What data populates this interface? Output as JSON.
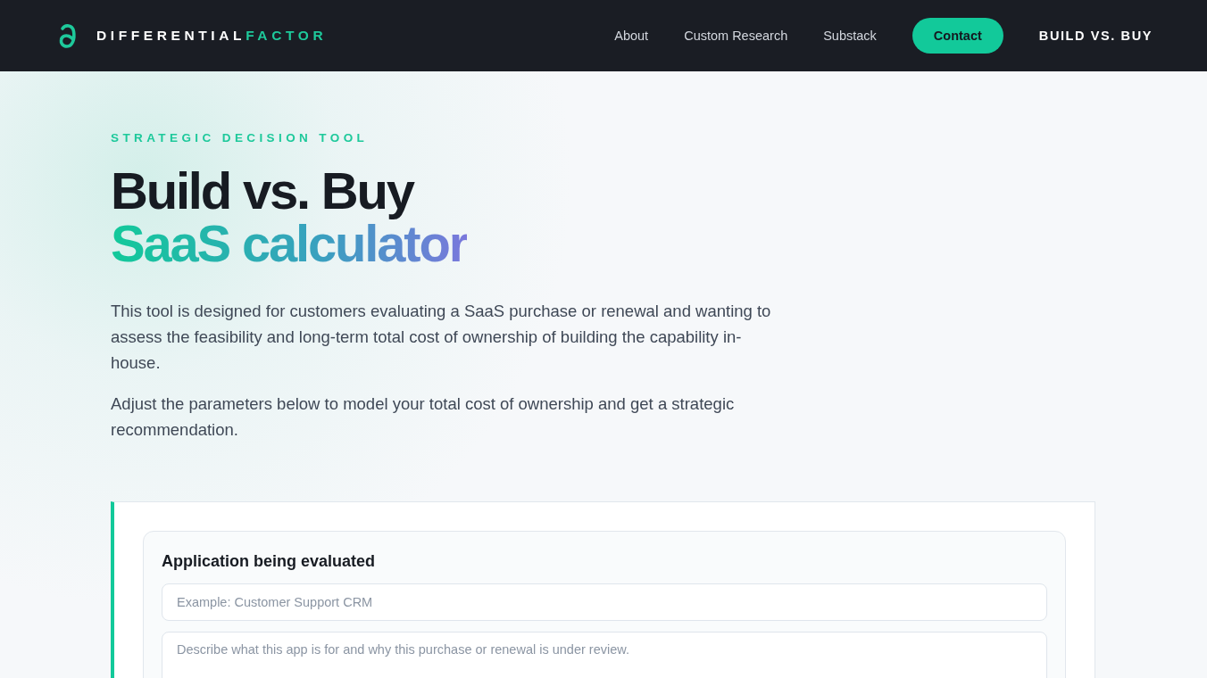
{
  "header": {
    "brand": {
      "part_1": "DIFFERENTIAL",
      "part_2": "FACTOR"
    },
    "nav": [
      {
        "label": "About",
        "kind": "link",
        "selected": false
      },
      {
        "label": "Custom Research",
        "kind": "link",
        "selected": false
      },
      {
        "label": "Substack",
        "kind": "link",
        "selected": false
      },
      {
        "label": "Contact",
        "kind": "button",
        "selected": false
      },
      {
        "label": "BUILD VS. BUY",
        "kind": "link",
        "selected": true
      }
    ]
  },
  "hero": {
    "eyebrow": "STRATEGIC DECISION TOOL",
    "title_line_1": "Build vs. Buy",
    "title_line_2": "SaaS calculator",
    "paragraphs": [
      "This tool is designed for customers evaluating a SaaS purchase or renewal and wanting to assess the feasibility and long-term total cost of ownership of building the capability in-house.",
      "Adjust the parameters below to model your total cost of ownership and get a strategic recommendation."
    ]
  },
  "application_card": {
    "heading": "Application being evaluated",
    "fields": [
      {
        "kind": "input",
        "placeholder": "Example: Customer Support CRM"
      },
      {
        "kind": "textarea",
        "placeholder": "Describe what this app is for and why this purchase or renewal is under review."
      }
    ]
  }
}
